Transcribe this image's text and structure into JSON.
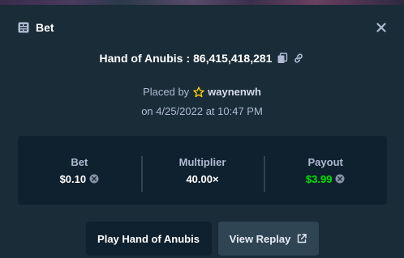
{
  "modal": {
    "title": "Bet",
    "game_name": "Hand of Anubis",
    "bet_id": "86,415,418,281",
    "placed_by_label": "Placed by",
    "username": "waynenwh",
    "date_line": "on 4/25/2022 at 10:47 PM"
  },
  "stats": {
    "bet": {
      "label": "Bet",
      "value": "$0.10"
    },
    "multiplier": {
      "label": "Multiplier",
      "value": "40.00×"
    },
    "payout": {
      "label": "Payout",
      "value": "$3.99"
    }
  },
  "buttons": {
    "play_label": "Play Hand of Anubis",
    "replay_label": "View Replay"
  },
  "icons": {
    "header": "bet-slip-icon",
    "close": "close-icon",
    "copy": "copy-icon",
    "link": "link-icon",
    "vip": "star-icon",
    "currency": "coin-icon",
    "external": "external-link-icon"
  },
  "colors": {
    "background": "#1a2c38",
    "panel": "#0f212e",
    "muted_text": "#b1bad3",
    "payout_green": "#00e701",
    "replay_button": "#2f4553",
    "star": "#ffd600"
  }
}
